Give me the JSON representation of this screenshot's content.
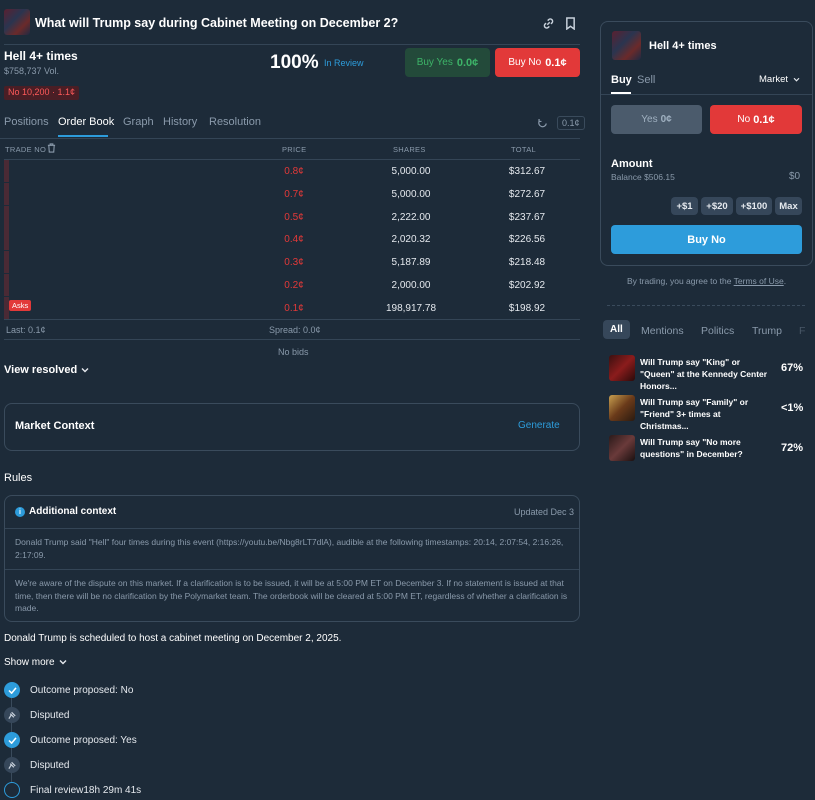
{
  "header": {
    "title": "What will Trump say during Cabinet Meeting on December 2?"
  },
  "market": {
    "name": "Hell 4+ times",
    "volume": "$758,737 Vol.",
    "position_badge": "No 10,200 · 1.1¢",
    "probability": "100%",
    "status": "In Review",
    "buy_yes_label": "Buy Yes",
    "buy_yes_price": "0.0¢",
    "buy_no_label": "Buy No",
    "buy_no_price": "0.1¢"
  },
  "tabs": [
    {
      "label": "Positions"
    },
    {
      "label": "Order Book"
    },
    {
      "label": "Graph"
    },
    {
      "label": "History"
    },
    {
      "label": "Resolution"
    }
  ],
  "tick_size": "0.1¢",
  "orderbook": {
    "columns": {
      "trade": "TRADE NO",
      "price": "PRICE",
      "shares": "SHARES",
      "total": "TOTAL"
    },
    "asks": [
      {
        "price": "0.8¢",
        "shares": "5,000.00",
        "total": "$312.67"
      },
      {
        "price": "0.7¢",
        "shares": "5,000.00",
        "total": "$272.67"
      },
      {
        "price": "0.5¢",
        "shares": "2,222.00",
        "total": "$237.67"
      },
      {
        "price": "0.4¢",
        "shares": "2,020.32",
        "total": "$226.56"
      },
      {
        "price": "0.3¢",
        "shares": "5,187.89",
        "total": "$218.48"
      },
      {
        "price": "0.2¢",
        "shares": "2,000.00",
        "total": "$202.92"
      },
      {
        "price": "0.1¢",
        "shares": "198,917.78",
        "total": "$198.92"
      }
    ],
    "asks_badge": "Asks",
    "last": "Last: 0.1¢",
    "spread": "Spread: 0.0¢",
    "no_bids": "No bids"
  },
  "view_resolved": "View resolved",
  "market_context": {
    "title": "Market Context",
    "generate": "Generate"
  },
  "rules": {
    "title": "Rules",
    "additional_context_title": "Additional context",
    "updated": "Updated Dec 3",
    "context_text": "Donald Trump said \"Hell\" four times during this event (https://youtu.be/Nbg8rLT7dlA), audible at the following timestamps: 20:14, 2:07:54, 2:16:26, 2:17:09.",
    "dispute_text": "We're aware of the dispute on this market. If a clarification is to be issued, it will be at 5:00 PM ET on December 3. If no statement is issued at that time, then there will be no clarification by the Polymarket team. The orderbook will be cleared at 5:00 PM ET, regardless of whether a clarification is made.",
    "description": "Donald Trump is scheduled to host a cabinet meeting on December 2, 2025.",
    "show_more": "Show more"
  },
  "timeline": [
    {
      "label": "Outcome proposed: No",
      "state": "check"
    },
    {
      "label": "Disputed",
      "state": "gavel"
    },
    {
      "label": "Outcome proposed: Yes",
      "state": "check"
    },
    {
      "label": "Disputed",
      "state": "gavel"
    },
    {
      "label": "Final review",
      "timer": "18h 29m 41s",
      "state": "open"
    }
  ],
  "trade_panel": {
    "market_name": "Hell 4+ times",
    "buy_tab": "Buy",
    "sell_tab": "Sell",
    "order_type": "Market",
    "yes_label": "Yes",
    "yes_price": "0¢",
    "no_label": "No",
    "no_price": "0.1¢",
    "amount_label": "Amount",
    "balance": "Balance $506.15",
    "amount_value": "$0",
    "quick": [
      "+$1",
      "+$20",
      "+$100",
      "Max"
    ],
    "buy_button": "Buy No",
    "terms_prefix": "By trading, you agree to the ",
    "terms_link": "Terms of Use",
    "terms_suffix": "."
  },
  "related": {
    "categories": [
      "All",
      "Mentions",
      "Politics",
      "Trump",
      "F"
    ],
    "items": [
      {
        "title": "Will Trump say \"King\" or \"Queen\" at the Kennedy Center Honors...",
        "pct": "67%"
      },
      {
        "title": "Will Trump say \"Family\" or \"Friend\" 3+ times at Christmas...",
        "pct": "<1%"
      },
      {
        "title": "Will Trump say \"No more questions\" in December?",
        "pct": "72%"
      }
    ]
  },
  "colors": {
    "background": "#1d2b39",
    "no_red": "#e23939",
    "yes_green": "#3db468",
    "accent_blue": "#2d9cdb"
  }
}
